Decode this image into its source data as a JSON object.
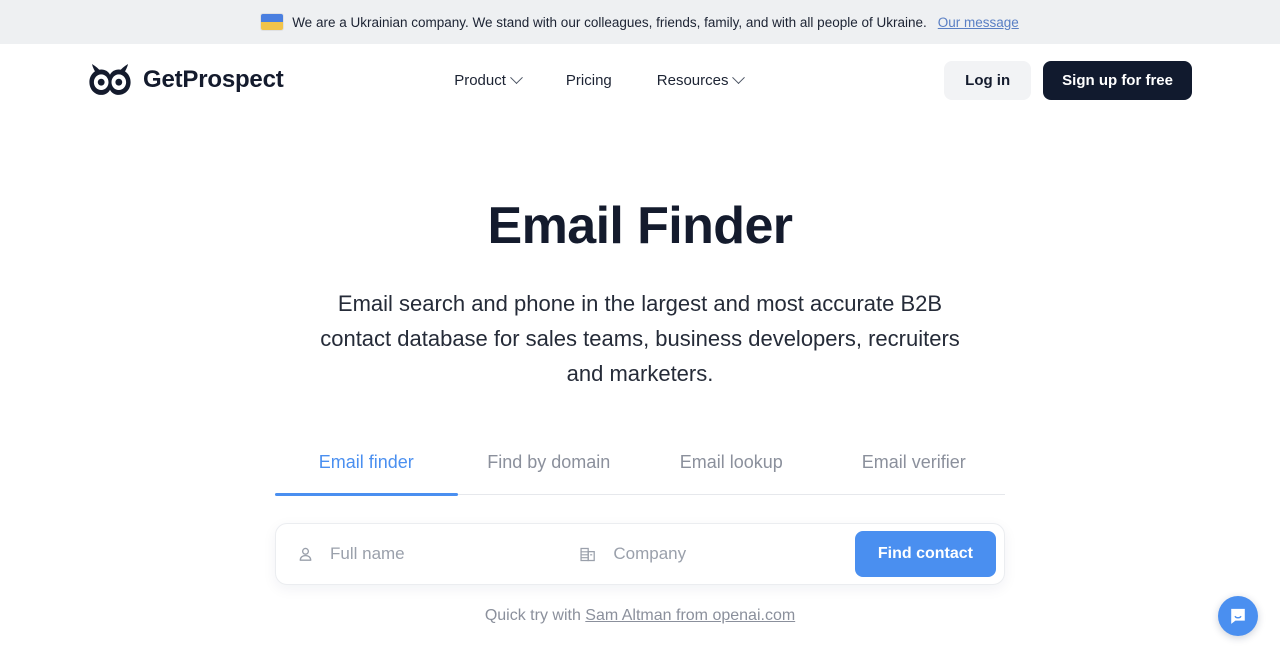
{
  "banner": {
    "flag_icon": "ukraine-flag-icon",
    "text": "We are a Ukrainian company. We stand with our colleagues, friends, family, and with all people of Ukraine.",
    "link_label": "Our message"
  },
  "header": {
    "logo_icon": "owl-logo-icon",
    "brand": "GetProspect",
    "nav": [
      {
        "label": "Product",
        "has_chevron": true
      },
      {
        "label": "Pricing",
        "has_chevron": false
      },
      {
        "label": "Resources",
        "has_chevron": true
      }
    ],
    "login_label": "Log in",
    "signup_label": "Sign up for free"
  },
  "hero": {
    "title": "Email Finder",
    "subtitle": "Email search and phone in the largest and most accurate B2B contact database for sales teams, business developers, recruiters and marketers."
  },
  "tabs": [
    {
      "label": "Email finder",
      "active": true
    },
    {
      "label": "Find by domain",
      "active": false
    },
    {
      "label": "Email lookup",
      "active": false
    },
    {
      "label": "Email verifier",
      "active": false
    }
  ],
  "search_form": {
    "name_icon": "person-icon",
    "name_placeholder": "Full name",
    "name_value": "",
    "company_icon": "building-icon",
    "company_placeholder": "Company",
    "company_value": "",
    "submit_label": "Find contact"
  },
  "quick_try": {
    "prefix": "Quick try with ",
    "link_label": "Sam Altman from openai.com"
  },
  "chat_widget": {
    "icon": "chat-bubble-icon"
  },
  "colors": {
    "accent_blue": "#4a8ff0",
    "dark_navy": "#141b2d",
    "banner_bg": "#eef0f2",
    "muted_gray": "#8b909c",
    "flag_blue": "#4a7fe0",
    "flag_yellow": "#f2c44a"
  }
}
